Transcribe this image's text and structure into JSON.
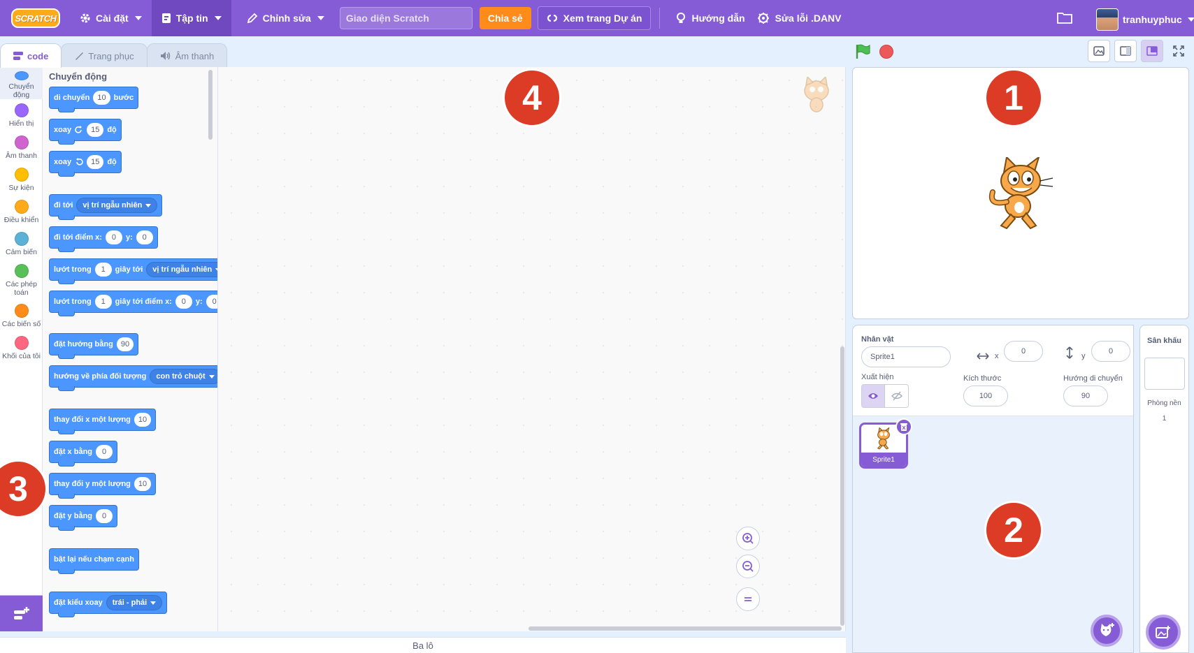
{
  "menu": {
    "logo": "SCRATCH",
    "settings": "Cài đặt",
    "file": "Tập tin",
    "edit": "Chỉnh sửa",
    "project_title": "Giao diện Scratch",
    "share": "Chia sẻ",
    "see_project": "Xem trang Dự án",
    "tutorials": "Hướng dẫn",
    "debug": "Sửa lỗi .DANV",
    "username": "tranhuyphuc"
  },
  "tabs": [
    "code",
    "Trang phục",
    "Âm thanh"
  ],
  "categories": [
    {
      "label": "Chuyển động",
      "color": "#4c97ff"
    },
    {
      "label": "Hiển thị",
      "color": "#9966ff"
    },
    {
      "label": "Âm thanh",
      "color": "#cf63cf"
    },
    {
      "label": "Sự kiện",
      "color": "#ffbf00"
    },
    {
      "label": "Điều khiển",
      "color": "#ffab19"
    },
    {
      "label": "Cảm biến",
      "color": "#5cb1d6"
    },
    {
      "label": "Các phép toán",
      "color": "#59c059"
    },
    {
      "label": "Các biến số",
      "color": "#ff8c1a"
    },
    {
      "label": "Khối của tôi",
      "color": "#ff6680"
    }
  ],
  "palette": {
    "title": "Chuyển động",
    "move": {
      "a": "di chuyển",
      "v": "10",
      "b": "bước"
    },
    "turn_right": {
      "a": "xoay",
      "v": "15",
      "b": "độ"
    },
    "turn_left": {
      "a": "xoay",
      "v": "15",
      "b": "độ"
    },
    "goto": {
      "a": "đi tới",
      "d": "vị trí ngẫu nhiên"
    },
    "goto_xy": {
      "a": "đi tới điểm x:",
      "x": "0",
      "b": "y:",
      "y": "0"
    },
    "glide": {
      "a": "lướt trong",
      "v": "1",
      "b": "giây tới",
      "d": "vị trí ngẫu nhiên"
    },
    "glide_xy": {
      "a": "lướt trong",
      "v": "1",
      "b": "giây tới điểm x:",
      "x": "0",
      "c": "y:",
      "y": "0"
    },
    "point_dir": {
      "a": "đặt hướng bằng",
      "v": "90"
    },
    "point_towards": {
      "a": "hướng về phía đối tượng",
      "d": "con trỏ chuột"
    },
    "change_x": {
      "a": "thay đổi x một lượng",
      "v": "10"
    },
    "set_x": {
      "a": "đặt x bằng",
      "v": "0"
    },
    "change_y": {
      "a": "thay đổi y một lượng",
      "v": "10"
    },
    "set_y": {
      "a": "đặt y bằng",
      "v": "0"
    },
    "bounce": {
      "a": "bật lại nếu chạm cạnh"
    },
    "rotation": {
      "a": "đặt kiểu xoay",
      "d": "trái - phải"
    }
  },
  "backpack": "Ba lô",
  "sprite_info": {
    "sprite_label": "Nhân vật",
    "sprite_name": "Sprite1",
    "x_label": "x",
    "x": "0",
    "y_label": "y",
    "y": "0",
    "show_label": "Xuất hiện",
    "size_label": "Kích thước",
    "size": "100",
    "direction_label": "Hướng di chuyển",
    "direction": "90"
  },
  "sprites": [
    {
      "name": "Sprite1"
    }
  ],
  "stage_pane": {
    "title": "Sân khấu",
    "backdrops_label": "Phòng nền",
    "backdrops_count": "1"
  },
  "callouts": [
    "1",
    "2",
    "3",
    "4"
  ],
  "colors": {
    "menu": "#855cd6",
    "motion": "#4c97ff",
    "share": "#ff8c1a",
    "callout": "#dc3b26"
  }
}
